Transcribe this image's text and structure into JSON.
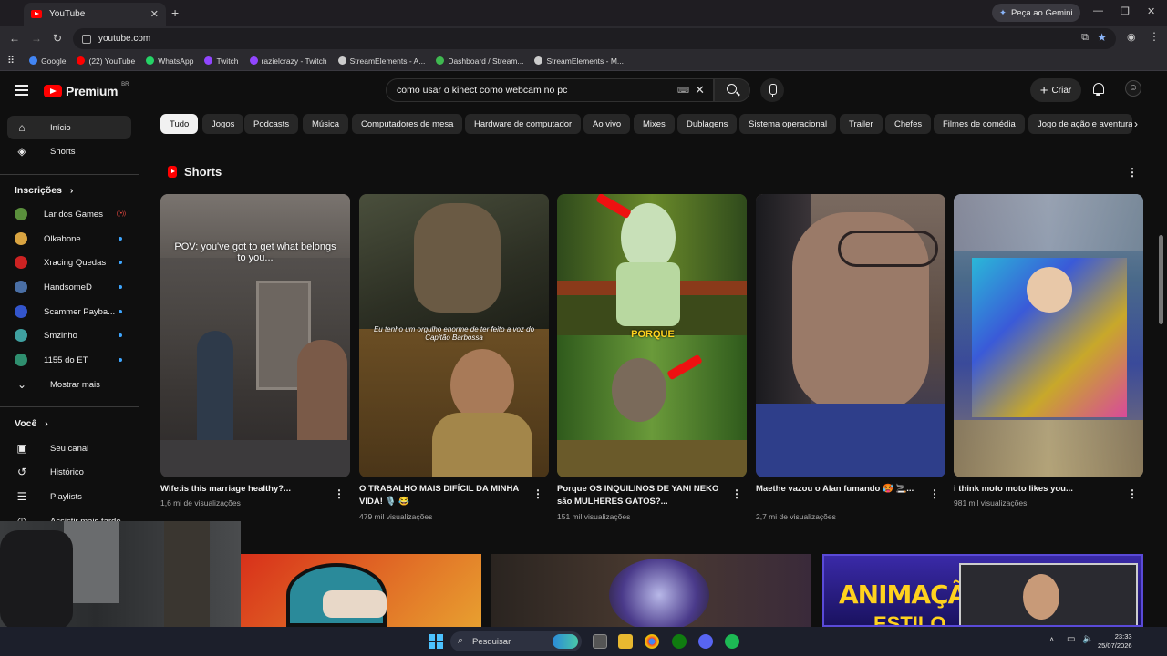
{
  "browser": {
    "tab_title": "YouTube",
    "new_tab": "+",
    "gemini_label": "Peça ao Gemini",
    "url": "youtube.com",
    "window_controls": [
      "—",
      "❐",
      "✕"
    ],
    "bookmarks": [
      {
        "label": "Google",
        "color": "#4285f4"
      },
      {
        "label": "(22) YouTube",
        "color": "#ff0000"
      },
      {
        "label": "WhatsApp",
        "color": "#25d366"
      },
      {
        "label": "Twitch",
        "color": "#9146ff"
      },
      {
        "label": "razielcrazy - Twitch",
        "color": "#9146ff"
      },
      {
        "label": "StreamElements - A...",
        "color": "#cccccc"
      },
      {
        "label": "Dashboard / Stream...",
        "color": "#3fb950"
      },
      {
        "label": "StreamElements - M...",
        "color": "#cccccc"
      }
    ]
  },
  "header": {
    "logo_word": "Premium",
    "region": "BR",
    "search_query": "como usar o kinect  como webcam no pc",
    "create_label": "Criar"
  },
  "sidebar": {
    "main": [
      {
        "label": "Início",
        "icon": "home-icon"
      },
      {
        "label": "Shorts",
        "icon": "shorts-icon"
      }
    ],
    "subscriptions_heading": "Inscrições",
    "subscriptions": [
      {
        "label": "Lar dos Games",
        "color": "#5a8f3c",
        "status": "live"
      },
      {
        "label": "Olkabone",
        "color": "#d9a441",
        "status": "dot"
      },
      {
        "label": "Xracing Quedas",
        "color": "#cc2222",
        "status": "dot"
      },
      {
        "label": "HandsomeD",
        "color": "#4a6fa5",
        "status": "dot"
      },
      {
        "label": "Scammer Payba...",
        "color": "#3355cc",
        "status": "dot"
      },
      {
        "label": "Smzinho",
        "color": "#3fa0a0",
        "status": "dot"
      },
      {
        "label": "1155 do ET",
        "color": "#2f8f6f",
        "status": "dot"
      }
    ],
    "show_more": "Mostrar mais",
    "you_heading": "Você",
    "you_items": [
      {
        "label": "Seu canal",
        "icon": "channel-icon"
      },
      {
        "label": "Histórico",
        "icon": "history-icon"
      },
      {
        "label": "Playlists",
        "icon": "playlist-icon"
      },
      {
        "label": "Assistir mais tarde",
        "icon": "watch-later-icon"
      }
    ]
  },
  "chips": [
    "Tudo",
    "Jogos",
    "Podcasts",
    "Música",
    "Computadores de mesa",
    "Hardware de computador",
    "Ao vivo",
    "Mixes",
    "Dublagens",
    "Sistema operacional",
    "Trailer",
    "Chefes",
    "Filmes de comédia",
    "Jogo de ação e aventura"
  ],
  "shorts": {
    "section_title": "Shorts",
    "items": [
      {
        "title": "Wife:is this marriage healthy?...",
        "views": "1,6 mi de visualizações",
        "overlay": "POV: you've got to get what belongs to you..."
      },
      {
        "title": "O TRABALHO MAIS DIFÍCIL DA MINHA VIDA! 🎙️ 😂",
        "views": "479 mil visualizações",
        "overlay": "Eu tenho um orgulho enorme de ter feito a voz do Capitão Barbossa"
      },
      {
        "title": "Porque OS INQUILINOS DE YANI NEKO são MULHERES GATOS?...",
        "views": "151 mil visualizações",
        "overlay": "PORQUE"
      },
      {
        "title": "Maethe vazou o Alan fumando 🥵 🚬...",
        "views": "2,7 mi de visualizações",
        "overlay": ""
      },
      {
        "title": "i think moto moto likes you...",
        "views": "981 mil visualizações",
        "overlay": ""
      }
    ]
  },
  "bottom_row": {
    "thumb3_text": "ANIMAÇÃO",
    "thumb3_text2": "ESTILO"
  },
  "taskbar": {
    "search_placeholder": "Pesquisar",
    "time": "23:33",
    "date": "25/07/2026"
  }
}
